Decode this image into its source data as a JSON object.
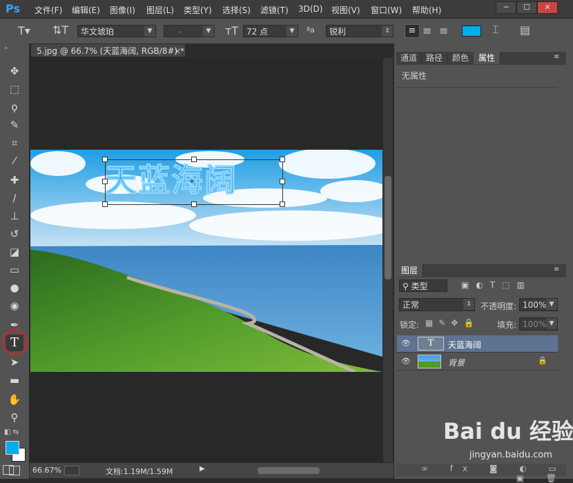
{
  "app": {
    "logo": "Ps"
  },
  "menu": [
    "文件(F)",
    "编辑(E)",
    "图像(I)",
    "图层(L)",
    "类型(Y)",
    "选择(S)",
    "滤镜(T)",
    "3D(D)",
    "视图(V)",
    "窗口(W)",
    "帮助(H)"
  ],
  "window_controls": [
    "─",
    "☐",
    "✕"
  ],
  "options": {
    "font_family": "华文琥珀",
    "font_style": "-",
    "font_size": "72 点",
    "aa_label": "ªa",
    "antialias": "锐利",
    "text_color": "#00aeef"
  },
  "document": {
    "tab_title": "5.jpg @ 66.7% (天蓝海阔, RGB/8#) *",
    "text_content": "天蓝海阔",
    "zoom": "66.67%",
    "doc_size": "文档:1.19M/1.59M"
  },
  "colors": {
    "foreground": "#00aeef",
    "background": "#ffffff"
  },
  "right_panel": {
    "tabs": [
      "通道",
      "路径",
      "颜色",
      "属性"
    ],
    "active_tab": "属性",
    "properties_text": "无属性",
    "layers_tab": "图层",
    "filter_kind": "类型",
    "blend_mode": "正常",
    "opacity_label": "不透明度:",
    "opacity_value": "100%",
    "lock_label": "锁定:",
    "fill_label": "填充:",
    "fill_value": "100%",
    "layers": [
      {
        "name": "天蓝海阔",
        "thumb": "T",
        "selected": true
      },
      {
        "name": "背景",
        "selected": false
      }
    ]
  },
  "watermark": {
    "text": "Bai du 经验",
    "url": "jingyan.baidu.com"
  }
}
